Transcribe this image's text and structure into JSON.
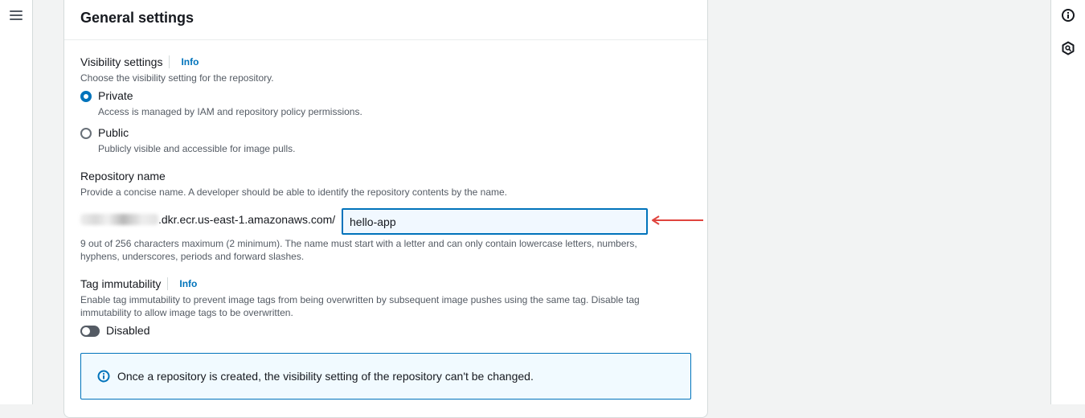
{
  "panel": {
    "title": "General settings"
  },
  "visibility": {
    "label": "Visibility settings",
    "info": "Info",
    "description": "Choose the visibility setting for the repository.",
    "options": [
      {
        "label": "Private",
        "description": "Access is managed by IAM and repository policy permissions.",
        "checked": true
      },
      {
        "label": "Public",
        "description": "Publicly visible and accessible for image pulls.",
        "checked": false
      }
    ]
  },
  "repository": {
    "label": "Repository name",
    "description": "Provide a concise name. A developer should be able to identify the repository contents by the name.",
    "prefix": ".dkr.ecr.us-east-1.amazonaws.com/",
    "value": "hello-app",
    "constraint_line1": "9 out of 256 characters maximum (2 minimum). The name must start with a letter and can only contain lowercase letters, numbers,",
    "constraint_line2": "hyphens, underscores, periods and forward slashes."
  },
  "tag_immutability": {
    "label": "Tag immutability",
    "info": "Info",
    "description_line1": "Enable tag immutability to prevent image tags from being overwritten by subsequent image pushes using the same tag. Disable tag",
    "description_line2": "immutability to allow image tags to be overwritten.",
    "toggle_label": "Disabled",
    "enabled": false
  },
  "alert": {
    "text": "Once a repository is created, the visibility setting of the repository can't be changed."
  },
  "icons": {
    "menu": "hamburger-menu-icon",
    "info_panel": "info-circle-icon",
    "secondary_panel": "hexagon-search-icon",
    "alert": "info-circle-icon",
    "annotation": "red-arrow-icon"
  },
  "colors": {
    "accent": "#0073bb",
    "annotation_arrow": "#e0443e"
  }
}
